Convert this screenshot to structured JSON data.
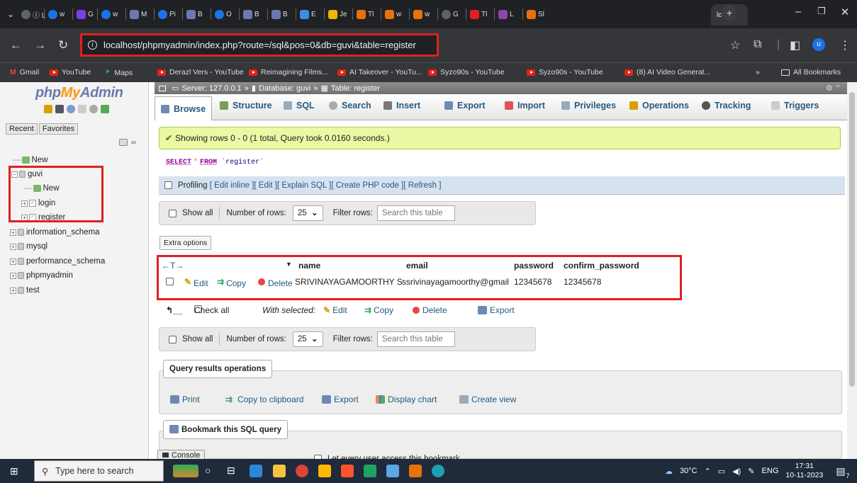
{
  "browser": {
    "active_tab_label": "lc",
    "tab_labels": [
      "Ⓘ L",
      "w",
      "G",
      "w",
      "M",
      "Pi",
      "B",
      "O",
      "B",
      "B",
      "E",
      "Je",
      "Tl",
      "w",
      "w",
      "G",
      "Tl",
      "L",
      "Sl"
    ],
    "url": "localhost/phpmyadmin/index.php?route=/sql&pos=0&db=guvi&table=register",
    "bookmarks": [
      "Gmail",
      "YouTube",
      "Maps",
      "Derazl Vers - YouTube",
      "Reimagining Films...",
      "AI Takeover - YouTu...",
      "Syzo90s - YouTube",
      "Syzo90s - YouTube",
      "(8) AI Video Generat..."
    ],
    "all_bookmarks": "All Bookmarks",
    "profile_initial": "u"
  },
  "pma": {
    "logo_php": "php",
    "logo_my": "My",
    "logo_admin": "Admin",
    "nav_tabs": [
      "Recent",
      "Favorites"
    ],
    "tree": {
      "new_top": "New",
      "db_guvi": "guvi",
      "new_guvi": "New",
      "table_login": "login",
      "table_register": "register",
      "db_info": "information_schema",
      "db_mysql": "mysql",
      "db_perf": "performance_schema",
      "db_pma": "phpmyadmin",
      "db_test": "test"
    },
    "breadcrumb": {
      "server": "Server: 127.0.0.1",
      "database": "Database: guvi",
      "table": "Table: register"
    },
    "tabs": [
      "Browse",
      "Structure",
      "SQL",
      "Search",
      "Insert",
      "Export",
      "Import",
      "Privileges",
      "Operations",
      "Tracking",
      "Triggers"
    ],
    "success_message": "Showing rows 0 - 0 (1 total, Query took 0.0160 seconds.)",
    "sql": {
      "select": "SELECT",
      "star": "*",
      "from": "FROM",
      "table": "`register`"
    },
    "profiling": {
      "label": "Profiling",
      "links": [
        "[ Edit inline ]",
        "[ Edit ]",
        "[ Explain SQL ]",
        "[ Create PHP code ]",
        "[ Refresh ]"
      ]
    },
    "navpanel": {
      "show_all": "Show all",
      "rows_label": "Number of rows:",
      "rows_value": "25",
      "filter_label": "Filter rows:",
      "filter_placeholder": "Search this table"
    },
    "extra_options": "Extra options",
    "columns": [
      "name",
      "email",
      "password",
      "confirm_password"
    ],
    "row": {
      "edit": "Edit",
      "copy": "Copy",
      "delete": "Delete",
      "name": "SRIVINAYAGAMOORTHY S",
      "email": "ssrivinayagamoorthy@gmail",
      "password": "12345678",
      "confirm_password": "12345678"
    },
    "bulk": {
      "check_all": "Check all",
      "with_selected": "With selected:",
      "edit": "Edit",
      "copy": "Copy",
      "delete": "Delete",
      "export": "Export"
    },
    "query_ops": {
      "legend": "Query results operations",
      "print": "Print",
      "copy_clipboard": "Copy to clipboard",
      "export": "Export",
      "display_chart": "Display chart",
      "create_view": "Create view"
    },
    "bookmark_legend": "Bookmark this SQL query",
    "console": "Console",
    "let_every_user": "Let every user access this bookmark"
  },
  "taskbar": {
    "search_placeholder": "Type here to search",
    "weather": "30°C",
    "lang": "ENG",
    "time": "17:31",
    "date": "10-11-2023",
    "notifications": "7"
  }
}
